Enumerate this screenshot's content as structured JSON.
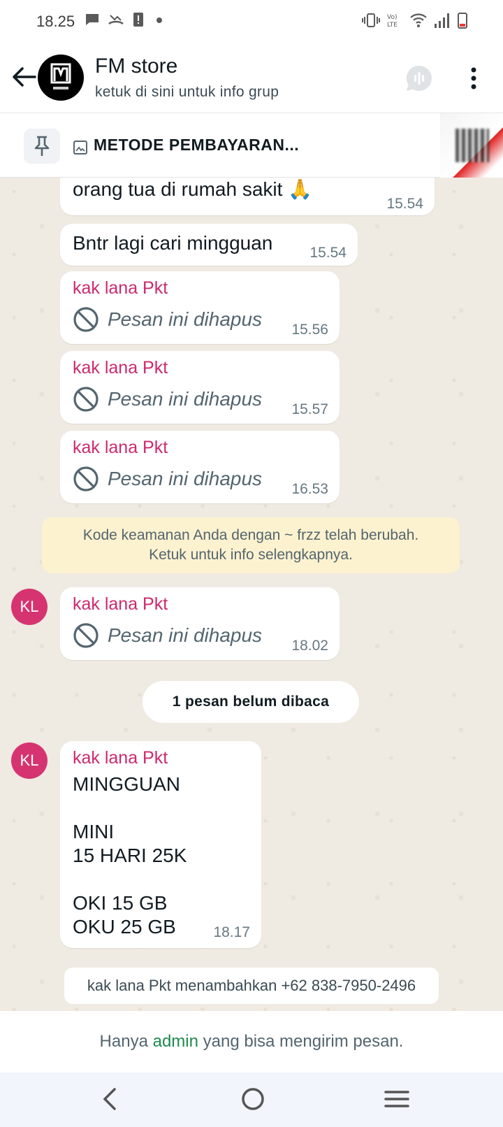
{
  "status_bar": {
    "time": "18.25"
  },
  "header": {
    "title": "FM store",
    "subtitle": "ketuk di sini untuk info grup"
  },
  "pinned": {
    "text": "METODE PEMBAYARAN..."
  },
  "messages": [
    {
      "text": "orang tua di rumah sakit 🙏",
      "time": "15.54"
    },
    {
      "text": "Bntr lagi cari mingguan",
      "time": "15.54"
    },
    {
      "sender": "kak lana Pkt",
      "deleted_text": "Pesan ini dihapus",
      "time": "15.56"
    },
    {
      "sender": "kak lana Pkt",
      "deleted_text": "Pesan ini dihapus",
      "time": "15.57"
    },
    {
      "sender": "kak lana Pkt",
      "deleted_text": "Pesan ini dihapus",
      "time": "16.53"
    },
    {
      "sender": "kak lana Pkt",
      "deleted_text": "Pesan ini dihapus",
      "time": "18.02",
      "avatar": "KL"
    },
    {
      "sender": "kak lana Pkt",
      "avatar": "KL",
      "time": "18.17",
      "lines": [
        "MINGGUAN",
        "MINI",
        "15 HARI 25K",
        "OKI 15 GB",
        "OKU 25 GB"
      ]
    }
  ],
  "security_notice": {
    "line1": "Kode keamanan Anda dengan ~ frzz telah berubah.",
    "line2": "Ketuk untuk info selengkapnya."
  },
  "unread_label": "1 pesan belum dibaca",
  "system_add": "kak lana Pkt menambahkan +62 838-7950-2496",
  "footer": {
    "before": "Hanya ",
    "link": "admin",
    "after": " yang bisa mengirim pesan."
  },
  "colors": {
    "sender": "#cc2a6e",
    "avatar_kl": "#d63471",
    "admin_link": "#1e8b4f",
    "chat_bg": "#efeae2",
    "notice_bg": "#fcf2cf"
  }
}
